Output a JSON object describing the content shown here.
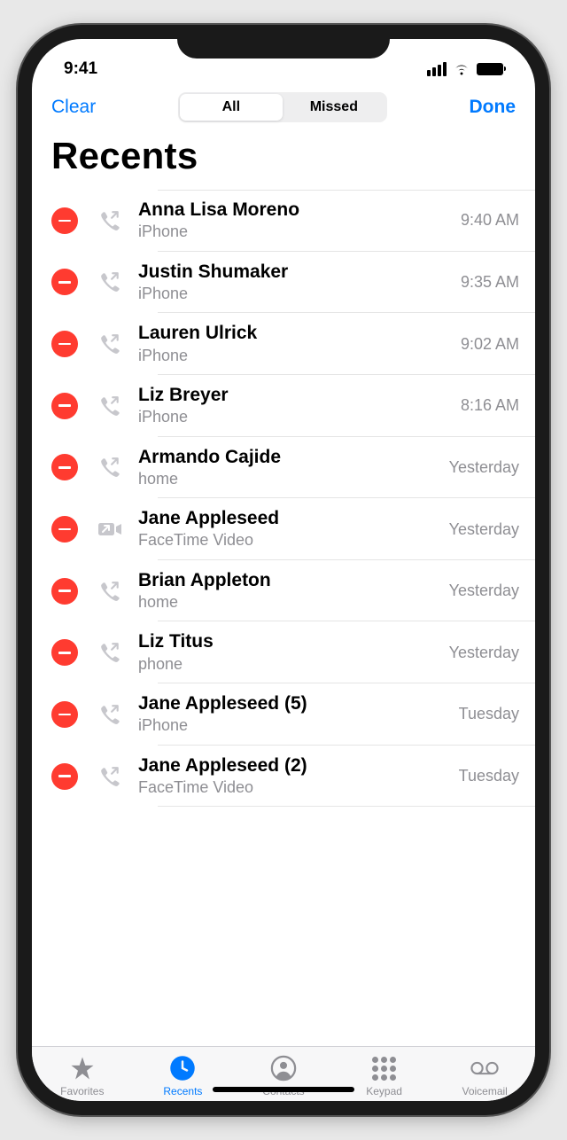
{
  "status": {
    "time": "9:41"
  },
  "nav": {
    "clear": "Clear",
    "done": "Done",
    "segments": {
      "all": "All",
      "missed": "Missed"
    }
  },
  "title": "Recents",
  "calls": [
    {
      "name": "Anna Lisa Moreno",
      "sub": "iPhone",
      "time": "9:40 AM",
      "iconType": "out-phone"
    },
    {
      "name": "Justin Shumaker",
      "sub": "iPhone",
      "time": "9:35 AM",
      "iconType": "out-phone"
    },
    {
      "name": "Lauren Ulrick",
      "sub": "iPhone",
      "time": "9:02 AM",
      "iconType": "out-phone"
    },
    {
      "name": "Liz Breyer",
      "sub": "iPhone",
      "time": "8:16 AM",
      "iconType": "out-phone"
    },
    {
      "name": "Armando Cajide",
      "sub": "home",
      "time": "Yesterday",
      "iconType": "out-phone"
    },
    {
      "name": "Jane Appleseed",
      "sub": "FaceTime Video",
      "time": "Yesterday",
      "iconType": "out-video"
    },
    {
      "name": "Brian Appleton",
      "sub": "home",
      "time": "Yesterday",
      "iconType": "out-phone"
    },
    {
      "name": "Liz Titus",
      "sub": "phone",
      "time": "Yesterday",
      "iconType": "out-phone"
    },
    {
      "name": "Jane Appleseed (5)",
      "sub": "iPhone",
      "time": "Tuesday",
      "iconType": "out-phone"
    },
    {
      "name": "Jane Appleseed (2)",
      "sub": "FaceTime Video",
      "time": "Tuesday",
      "iconType": "out-phone"
    }
  ],
  "tabs": {
    "favorites": "Favorites",
    "recents": "Recents",
    "contacts": "Contacts",
    "keypad": "Keypad",
    "voicemail": "Voicemail"
  }
}
